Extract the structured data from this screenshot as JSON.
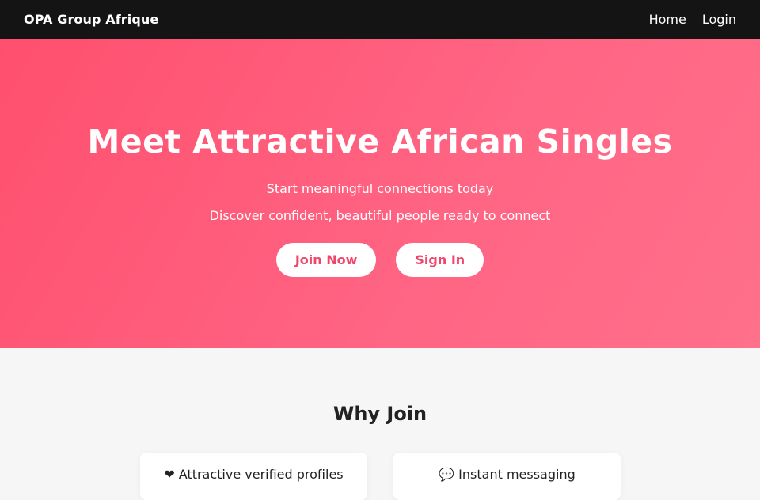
{
  "navbar": {
    "brand": "OPA Group Afrique",
    "links": [
      "Home",
      "Login"
    ]
  },
  "hero": {
    "title": "Meet Attractive African Singles",
    "subtitle": "Start meaningful connections today",
    "tagline": "Discover confident, beautiful people ready to connect",
    "buttons": {
      "join": "Join Now",
      "signin": "Sign In"
    }
  },
  "why": {
    "title": "Why Join",
    "features": [
      {
        "icon": "heart-icon",
        "glyph": "❤",
        "label": "Attractive verified profiles"
      },
      {
        "icon": "chat-icon",
        "glyph": "💬",
        "label": "Instant messaging"
      }
    ]
  },
  "colors": {
    "navbar_bg": "#141414",
    "hero_gradient_start": "#ff4f6e",
    "hero_gradient_end": "#ff708a",
    "button_text": "#f0466a",
    "section_bg": "#f6f6f6"
  }
}
